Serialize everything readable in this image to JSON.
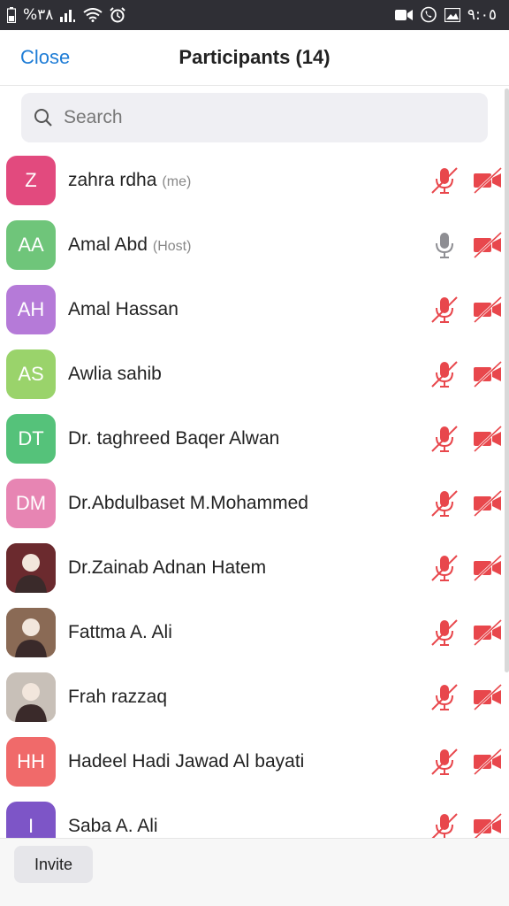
{
  "status_bar": {
    "battery_text": "%٣٨",
    "time": "٩:٠٥"
  },
  "header": {
    "close_label": "Close",
    "title": "Participants (14)"
  },
  "search": {
    "placeholder": "Search"
  },
  "participants": [
    {
      "name": "zahra rdha",
      "role": "(me)",
      "initials": "Z",
      "avatar_color": "#e24a7e",
      "mic": "muted",
      "video": "off"
    },
    {
      "name": "Amal Abd",
      "role": "(Host)",
      "initials": "AA",
      "avatar_color": "#6fc57a",
      "mic": "on",
      "video": "off"
    },
    {
      "name": "Amal Hassan",
      "role": "",
      "initials": "AH",
      "avatar_color": "#b57ad8",
      "mic": "muted",
      "video": "off"
    },
    {
      "name": "Awlia sahib",
      "role": "",
      "initials": "AS",
      "avatar_color": "#9ad36b",
      "mic": "muted",
      "video": "off"
    },
    {
      "name": "Dr. taghreed Baqer Alwan",
      "role": "",
      "initials": "DT",
      "avatar_color": "#55c27a",
      "mic": "muted",
      "video": "off"
    },
    {
      "name": "Dr.Abdulbaset M.Mohammed",
      "role": "",
      "initials": "DM",
      "avatar_color": "#e785b3",
      "mic": "muted",
      "video": "off"
    },
    {
      "name": "Dr.Zainab Adnan Hatem",
      "role": "",
      "initials": "",
      "avatar_color": "#6b2a2e",
      "mic": "muted",
      "video": "off"
    },
    {
      "name": "Fattma A. Ali",
      "role": "",
      "initials": "",
      "avatar_color": "#8a6a55",
      "mic": "muted",
      "video": "off"
    },
    {
      "name": "Frah razzaq",
      "role": "",
      "initials": "",
      "avatar_color": "#c8c0b8",
      "mic": "muted",
      "video": "off"
    },
    {
      "name": "Hadeel Hadi Jawad Al bayati",
      "role": "",
      "initials": "HH",
      "avatar_color": "#f06a6a",
      "mic": "muted",
      "video": "off"
    },
    {
      "name": "Saba A. Ali",
      "role": "",
      "initials": "I",
      "avatar_color": "#7d55c7",
      "mic": "muted",
      "video": "off"
    }
  ],
  "colors": {
    "accent": "#1f7dd6",
    "muted_red": "#e8474c",
    "mic_on_gray": "#8e8e93"
  },
  "footer": {
    "invite_label": "Invite"
  }
}
